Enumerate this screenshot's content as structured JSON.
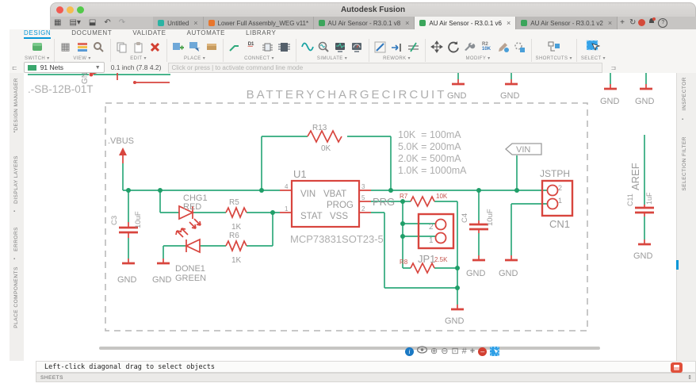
{
  "window": {
    "title": "Autodesk Fusion"
  },
  "tabbar": {
    "tabs": [
      {
        "label": "Untitled",
        "color": "#2bb3a3"
      },
      {
        "label": "Lower Full Assembly_WEG v11*",
        "color": "#e8762d"
      },
      {
        "label": "AU Air Sensor - R3.0.1 v8",
        "color": "#3ba55b"
      },
      {
        "label": "AU Air Sensor - R3.0.1 v6",
        "color": "#3ba55b"
      },
      {
        "label": "AU Air Sensor - R3.0.1 v2",
        "color": "#3ba55b"
      }
    ],
    "close": "×",
    "new_tab": "+"
  },
  "menubar": {
    "items": [
      "DESIGN",
      "DOCUMENT",
      "VALIDATE",
      "AUTOMATE",
      "LIBRARY"
    ],
    "active": "DESIGN",
    "accent": "#0696d7"
  },
  "toolbar": {
    "groups": [
      "SWITCH ▾",
      "VIEW ▾",
      "EDIT ▾",
      "PLACE ▾",
      "CONNECT ▾",
      "SIMULATE ▾",
      "REWORK ▾",
      "MODIFY ▾",
      "SHORTCUTS ▾",
      "SELECT ▾"
    ],
    "d1": "D1",
    "r2": "R2",
    "r2v": "10K"
  },
  "controls": {
    "nets": "91 Nets",
    "grid": "0.1 inch (7.8 4.2)",
    "command_placeholder": "Click or press | to activate command line mode"
  },
  "panels": {
    "left": [
      "DESIGN MANAGER",
      "DISPLAY LAYERS",
      "ERRORS",
      "PLACE COMPONENTS"
    ],
    "right": [
      "INSPECTOR",
      "SELECTION FILTER"
    ]
  },
  "sch": {
    "part_sw": ".-SB-12B-01T",
    "gnd": "GND",
    "title": "BATTERYCHARGECIRCUIT",
    "vbus": ".VBUS",
    "r13": "R13",
    "r13v": "0K",
    "u1": "U1",
    "u1v": "MCP73831SOT23-5",
    "vin": "VIN",
    "vbat": "VBAT",
    "prog": "PROG",
    "stat": "STAT",
    "vss": "VSS",
    "p4": "4",
    "p1": "1",
    "p3": "3",
    "p5": "5",
    "p2": "2",
    "prg": "PRG",
    "chg1": "CHG1",
    "chg1v": "RED",
    "done1": "DONE1",
    "done1v": "GREEN",
    "r5": "R5",
    "r5v": "1K",
    "r6": "R6",
    "r6v": "1K",
    "c3": "C3",
    "c3v": "10uF",
    "r7": "R7",
    "r7v": "10K",
    "r8": "R8",
    "r8v": "2.5K",
    "jp1": "JP1",
    "c4": "C4",
    "c4v": "10uF",
    "jstph": "JSTPH",
    "cn1": "CN1",
    "vinflag": "VIN",
    "aref": "AREF",
    "c11": "C11",
    "c11v": "1uF",
    "notes": [
      "10K  = 100mA",
      "5.0K = 200mA",
      "2.0K = 500mA",
      "1.0K = 1000mA"
    ]
  },
  "bottom_bar": {
    "icons": [
      "info",
      "eye",
      "zoom-in",
      "zoom-out",
      "zoom-fit",
      "grid",
      "crosshair",
      "remove",
      "select-window"
    ]
  },
  "status": {
    "hint": "Left-click diagonal drag to select objects",
    "sheets": "SHEETS"
  },
  "colors": {
    "wire": "#2fa97c",
    "component": "#d8453e",
    "accent": "#0696d7",
    "label_gray": "#9b9b9b"
  }
}
